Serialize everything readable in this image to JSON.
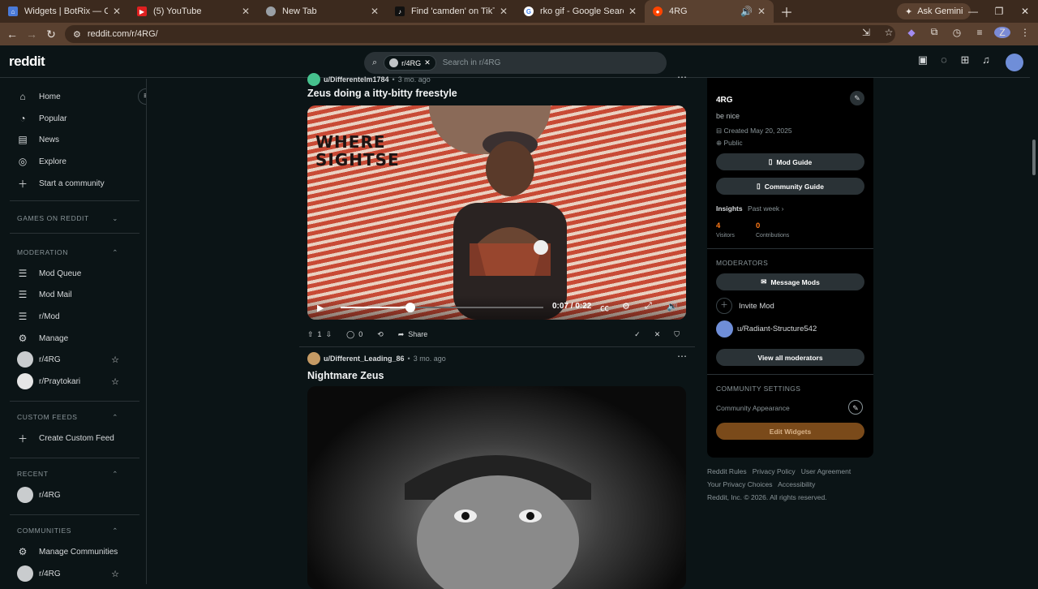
{
  "browser": {
    "tabs": [
      {
        "title": "Widgets | BotRix — Cloud Strea",
        "favicon": "tab-favicon-botrix",
        "color": "#4a7ad8",
        "active": false
      },
      {
        "title": "(5) YouTube",
        "favicon": "youtube-icon",
        "color": "#e02020",
        "active": false
      },
      {
        "title": "New Tab",
        "favicon": "chrome-icon",
        "color": "#9aa0a6",
        "active": false
      },
      {
        "title": "Find 'camden' on TikTok | TikTo",
        "favicon": "tiktok-icon",
        "color": "#111111",
        "active": false
      },
      {
        "title": "rko gif - Google Search",
        "favicon": "google-icon",
        "color": "#ffffff",
        "active": false
      },
      {
        "title": "4RG",
        "favicon": "reddit-icon",
        "color": "#ff4500",
        "active": true
      }
    ],
    "gemini_label": "Ask Gemini",
    "url": "reddit.com/r/4RG/",
    "profile_initial": "Z"
  },
  "header": {
    "logo": "reddit",
    "search_chip": "r/4RG",
    "search_placeholder": "Search in r/4RG"
  },
  "sidebar": {
    "nav": [
      "Home",
      "Popular",
      "News",
      "Explore",
      "Start a community"
    ],
    "games_label": "GAMES ON REDDIT",
    "moderation_label": "MODERATION",
    "moderation": [
      "Mod Queue",
      "Mod Mail",
      "r/Mod",
      "Manage",
      "r/4RG",
      "r/Praytokari"
    ],
    "custom_feeds_label": "CUSTOM FEEDS",
    "create_feed": "Create Custom Feed",
    "recent_label": "RECENT",
    "recent": [
      "r/4RG"
    ],
    "communities_label": "COMMUNITIES",
    "manage_communities": "Manage Communities",
    "communities": [
      "r/4RG"
    ]
  },
  "posts": [
    {
      "author": "u/Differentelm1784",
      "age": "3 mo. ago",
      "title": "Zeus doing a itty-bitty freestyle",
      "overlay_text": "WHERE SIGHTSE",
      "time": "0:07 / 0:22",
      "progress": 0.345,
      "votes": "1",
      "comments": "0",
      "share": "Share"
    },
    {
      "author": "u/Different_Leading_86",
      "age": "3 mo. ago",
      "title": "Nightmare Zeus"
    }
  ],
  "community": {
    "name": "4RG",
    "description": "be nice",
    "created": "Created May 20, 2025",
    "visibility": "Public",
    "mod_guide": "Mod Guide",
    "community_guide": "Community Guide",
    "insights_label": "Insights",
    "insights_period": "Past week",
    "visitors": "4",
    "visitors_label": "Visitors",
    "contributions": "0",
    "contributions_label": "Contributions",
    "moderators_label": "MODERATORS",
    "message_mods": "Message Mods",
    "invite_mod": "Invite Mod",
    "moderator": "u/Radiant-Structure542",
    "view_all_mods": "View all moderators",
    "settings_label": "COMMUNITY SETTINGS",
    "appearance": "Community Appearance",
    "edit_widgets": "Edit Widgets",
    "accent_color": "#ff7a18",
    "edit_widgets_bg": "#7a4a1a"
  },
  "footer": {
    "links1": [
      "Reddit Rules",
      "Privacy Policy",
      "User Agreement"
    ],
    "links2": [
      "Your Privacy Choices",
      "Accessibility"
    ],
    "copyright": "Reddit, Inc. © 2026. All rights reserved."
  }
}
